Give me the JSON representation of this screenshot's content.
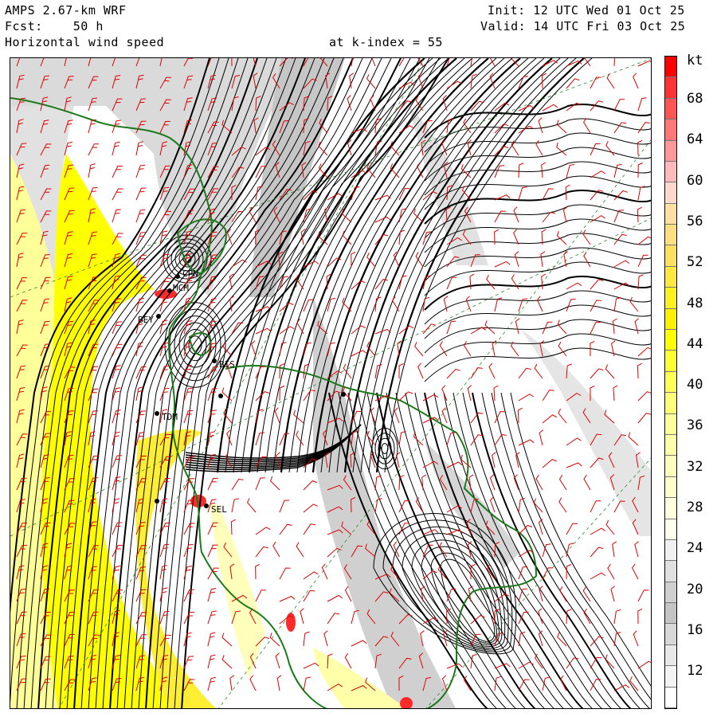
{
  "header": {
    "model": "AMPS 2.67-km WRF",
    "forecast_label": "Fcst:",
    "forecast_hours": "50 h",
    "field": "Horizontal wind speed",
    "level_label": "at k-index =",
    "level_value": "55",
    "init_label": "Init:",
    "init_time": "12 UTC Wed 01 Oct 25",
    "valid_label": "Valid:",
    "valid_time": "14 UTC Fri 03 Oct 25"
  },
  "colorbar": {
    "units": "kt",
    "labels": [
      "68",
      "64",
      "60",
      "56",
      "52",
      "48",
      "44",
      "40",
      "36",
      "32",
      "28",
      "24",
      "20",
      "16",
      "12"
    ],
    "colors": [
      {
        "min": 70,
        "color": "#ff0000"
      },
      {
        "min": 68,
        "color": "#ff3333"
      },
      {
        "min": 66,
        "color": "#ff5555"
      },
      {
        "min": 64,
        "color": "#ff7777"
      },
      {
        "min": 62,
        "color": "#ff9999"
      },
      {
        "min": 60,
        "color": "#ffbbbb"
      },
      {
        "min": 58,
        "color": "#ffd9cc"
      },
      {
        "min": 56,
        "color": "#ffe0a0"
      },
      {
        "min": 54,
        "color": "#ffe080"
      },
      {
        "min": 52,
        "color": "#ffe060"
      },
      {
        "min": 50,
        "color": "#ffe840"
      },
      {
        "min": 48,
        "color": "#fff020"
      },
      {
        "min": 46,
        "color": "#fff000"
      },
      {
        "min": 44,
        "color": "#ffff00"
      },
      {
        "min": 42,
        "color": "#ffff33"
      },
      {
        "min": 40,
        "color": "#ffff55"
      },
      {
        "min": 38,
        "color": "#ffff77"
      },
      {
        "min": 36,
        "color": "#ffff99"
      },
      {
        "min": 34,
        "color": "#ffffaa"
      },
      {
        "min": 32,
        "color": "#ffffbb"
      },
      {
        "min": 30,
        "color": "#ffffcc"
      },
      {
        "min": 28,
        "color": "#ffffdd"
      },
      {
        "min": 26,
        "color": "#ffffee"
      },
      {
        "min": 24,
        "color": "#f0f0f0"
      },
      {
        "min": 22,
        "color": "#e0e0e0"
      },
      {
        "min": 20,
        "color": "#d0d0d0"
      },
      {
        "min": 18,
        "color": "#c4c4c4"
      },
      {
        "min": 16,
        "color": "#d8d8d8"
      },
      {
        "min": 14,
        "color": "#e8e8e8"
      },
      {
        "min": 12,
        "color": "#f4f4f4"
      },
      {
        "min": 0,
        "color": "#ffffff"
      }
    ]
  },
  "stations": [
    "CPN",
    "MCM",
    "BEY",
    "BIS",
    "TDM",
    "SEL"
  ],
  "map_colors": {
    "streamline": "#000000",
    "barb": "#dd0000",
    "coastline": "#1a7a1a",
    "grid": "#2a8a2a",
    "jet_fill": "#ffff00",
    "light_fill": "#ffff99",
    "gray_fill": "#cfcfcf"
  }
}
